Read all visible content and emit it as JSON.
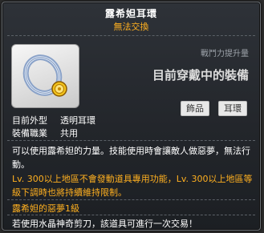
{
  "item": {
    "name": "露希妲耳環",
    "trade_status": "無法交換",
    "icon": "earring-icon"
  },
  "power_label": "戰鬥力提升量",
  "equipped_text": "目前穿戴中的裝備",
  "tags": [
    "飾品",
    "耳環"
  ],
  "attributes": [
    {
      "label": "目前外型",
      "value": "透明耳環"
    },
    {
      "label": "裝備職業",
      "value": "共用"
    }
  ],
  "description": "可以使用露希妲的力量。技能使用時會讓敵人做惡夢，無法行動。",
  "restriction": "Lv. 300以上地區不會發動道具專用功能，Lv. 300以上地區等級下調時也將持續維持限制。",
  "soul_level": "露希妲的惡夢1級",
  "scissors_note": "若使用水晶神奇剪刀，該道具可進行一次交易！",
  "colors": {
    "accent_orange": "#ffb020",
    "background": "#23262b"
  }
}
